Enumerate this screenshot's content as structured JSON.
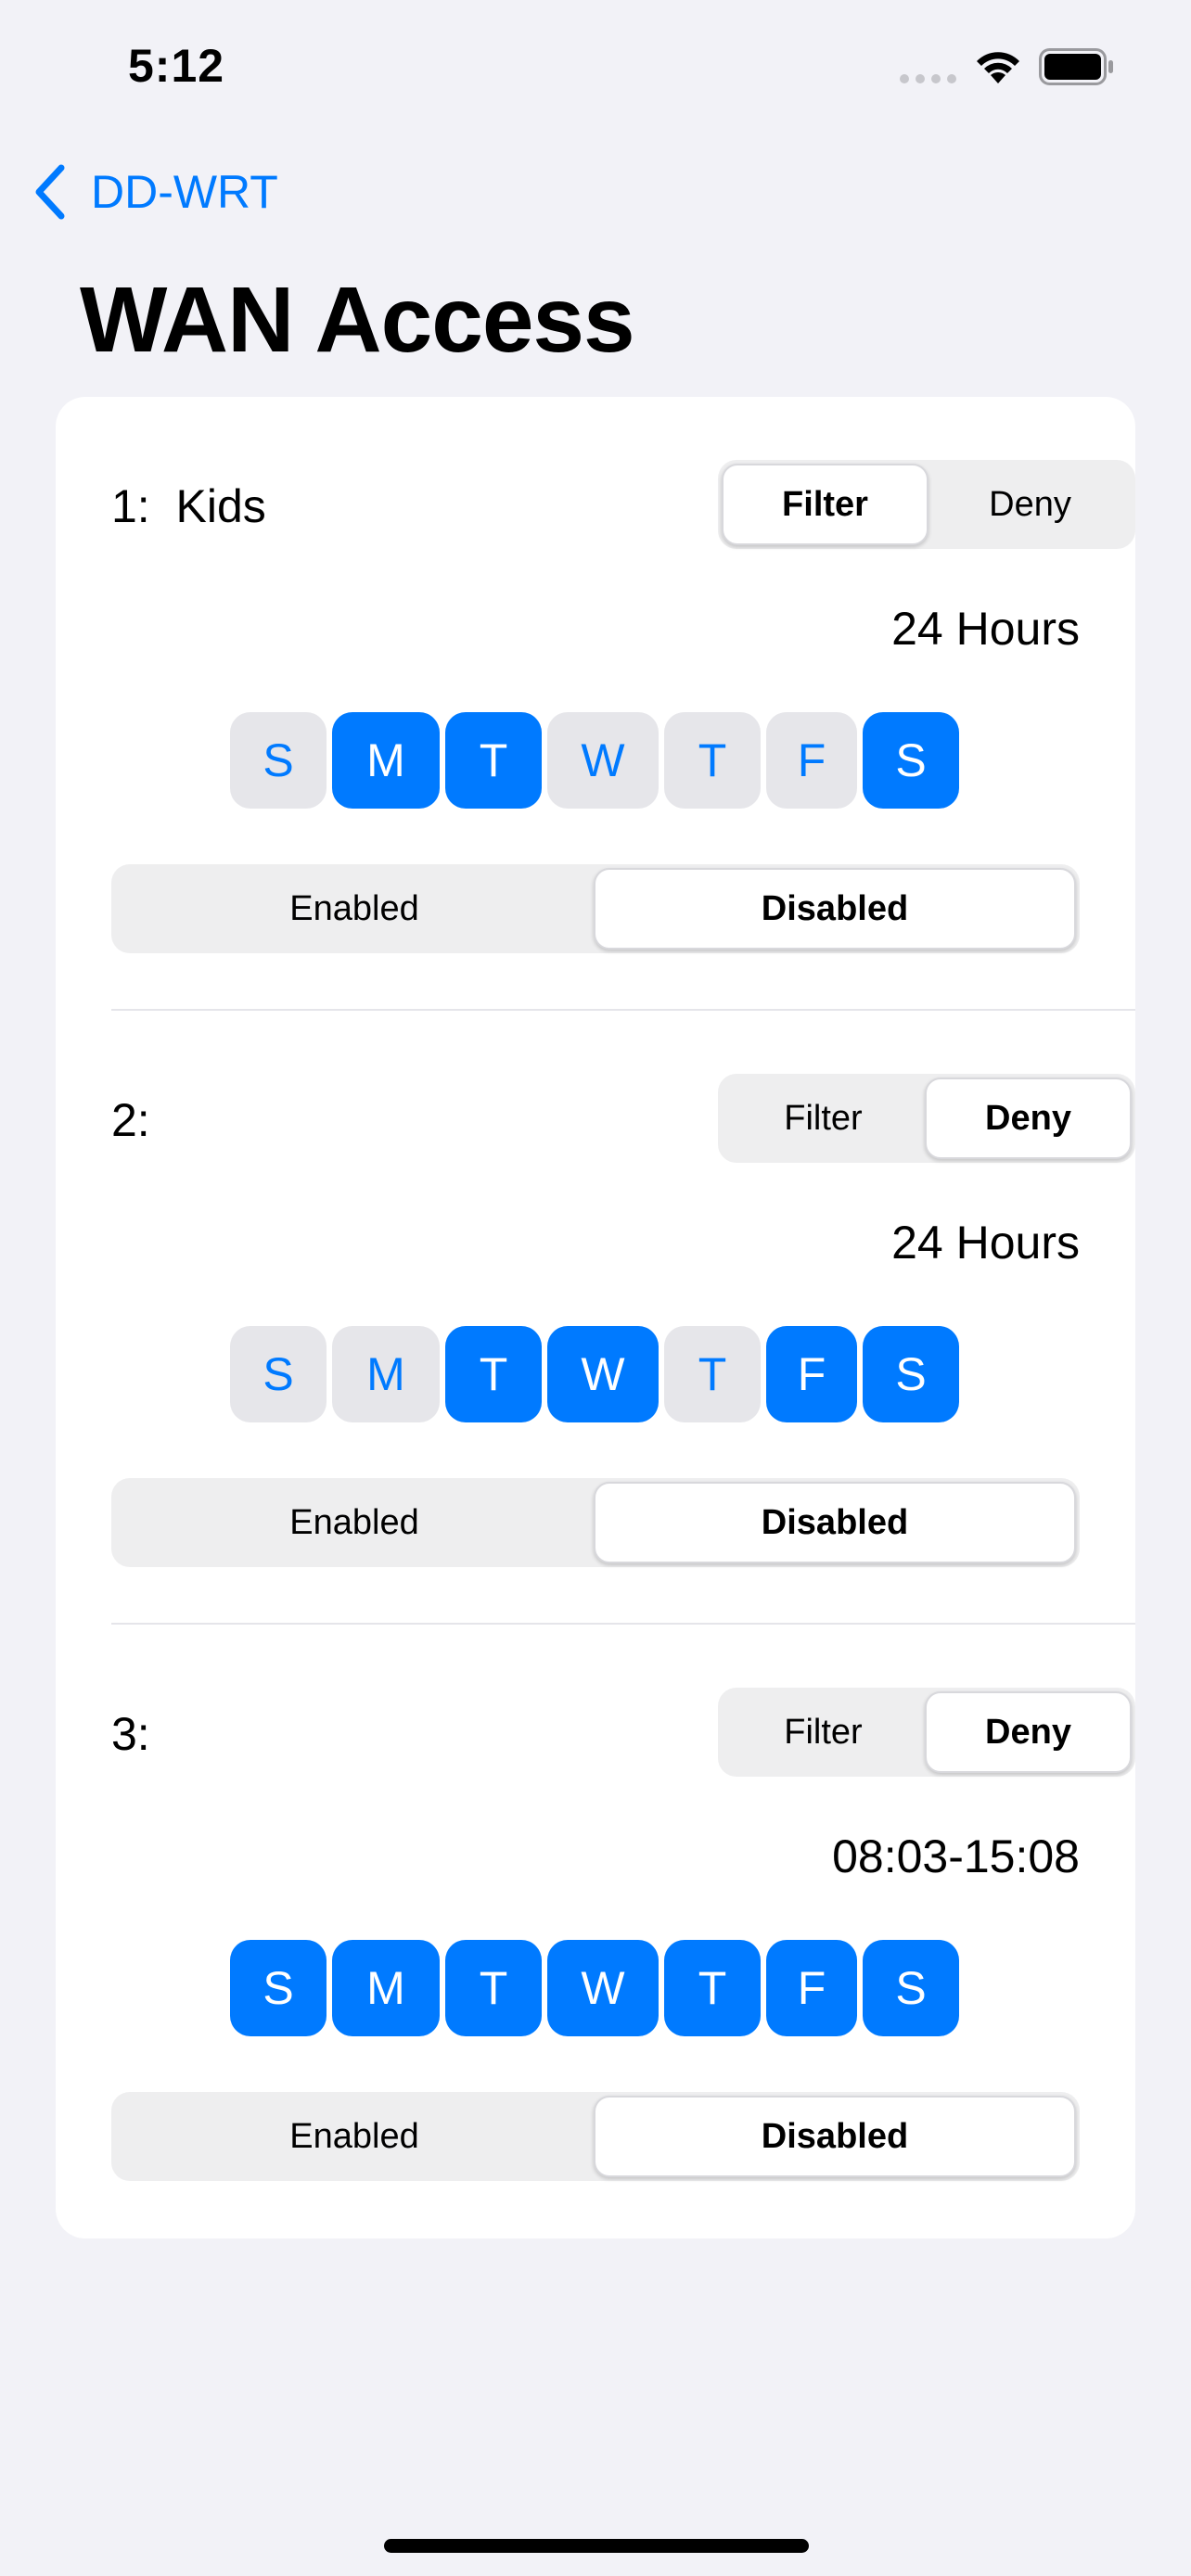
{
  "status": {
    "time": "5:12"
  },
  "nav": {
    "back_label": "DD-WRT"
  },
  "page": {
    "title": "WAN Access"
  },
  "mode_options": [
    "Filter",
    "Deny"
  ],
  "state_options": [
    "Enabled",
    "Disabled"
  ],
  "rules": [
    {
      "label": "1:  Kids",
      "mode": "Filter",
      "time": "24 Hours",
      "days": [
        {
          "letter": "S",
          "on": false
        },
        {
          "letter": "M",
          "on": true
        },
        {
          "letter": "T",
          "on": true
        },
        {
          "letter": "W",
          "on": false
        },
        {
          "letter": "T",
          "on": false
        },
        {
          "letter": "F",
          "on": false
        },
        {
          "letter": "S",
          "on": true
        }
      ],
      "state": "Disabled"
    },
    {
      "label": "2:",
      "mode": "Deny",
      "time": "24 Hours",
      "days": [
        {
          "letter": "S",
          "on": false
        },
        {
          "letter": "M",
          "on": false
        },
        {
          "letter": "T",
          "on": true
        },
        {
          "letter": "W",
          "on": true
        },
        {
          "letter": "T",
          "on": false
        },
        {
          "letter": "F",
          "on": true
        },
        {
          "letter": "S",
          "on": true
        }
      ],
      "state": "Disabled"
    },
    {
      "label": "3:",
      "mode": "Deny",
      "time": "08:03-15:08",
      "days": [
        {
          "letter": "S",
          "on": true
        },
        {
          "letter": "M",
          "on": true
        },
        {
          "letter": "T",
          "on": true
        },
        {
          "letter": "W",
          "on": true
        },
        {
          "letter": "T",
          "on": true
        },
        {
          "letter": "F",
          "on": true
        },
        {
          "letter": "S",
          "on": true
        }
      ],
      "state": "Disabled"
    }
  ],
  "colors": {
    "accent": "#007aff",
    "background": "#f2f2f7",
    "card": "#ffffff",
    "day_off": "#e6e6ea",
    "segment_track": "#eeeeef"
  }
}
